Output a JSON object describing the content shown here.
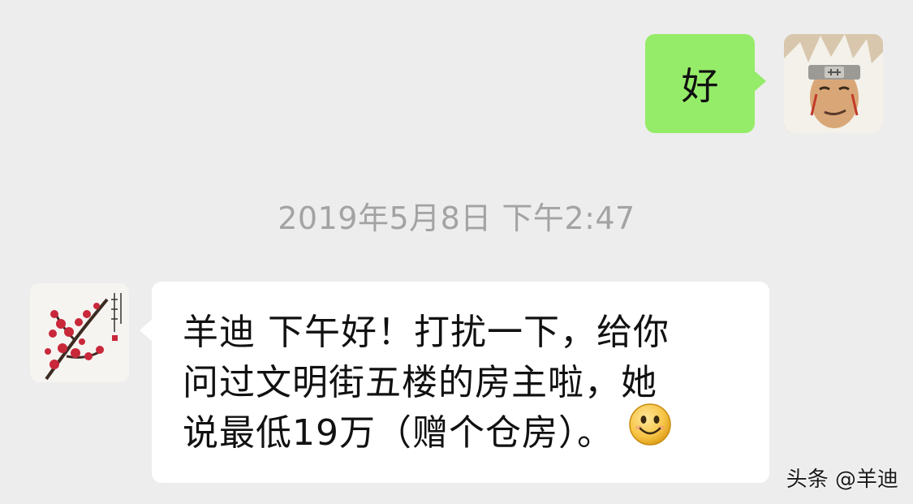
{
  "messages": {
    "outgoing": {
      "text": "好",
      "bubble_color": "#95ec69"
    },
    "timestamp": "2019年5月8日 下午2:47",
    "incoming": {
      "lines": [
        "羊迪 下午好！打扰一下，给你",
        "问过文明街五楼的房主啦，她",
        "说最低19万（赠个仓房）。"
      ],
      "emoji": "smile-emoji",
      "bubble_color": "#ffffff"
    }
  },
  "avatars": {
    "self_icon": "anime-character-avatar-icon",
    "other_icon": "plum-blossom-painting-avatar-icon"
  },
  "watermark": "头条 @羊迪",
  "colors": {
    "background": "#ededed",
    "timestamp": "#a3a3a3"
  }
}
